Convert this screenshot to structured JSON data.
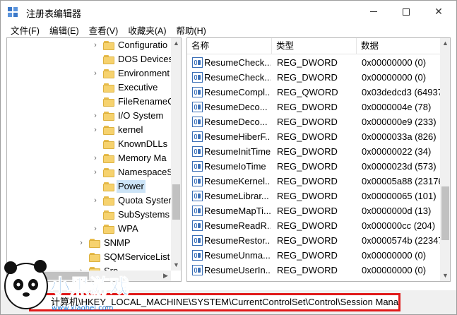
{
  "window": {
    "title": "注册表编辑器",
    "controls": {
      "minimize": "minimize",
      "maximize": "maximize",
      "close": "✕"
    }
  },
  "menu": [
    "文件(F)",
    "编辑(E)",
    "查看(V)",
    "收藏夹(A)",
    "帮助(H)"
  ],
  "tree": {
    "items": [
      {
        "label": "Configuratio",
        "level": 2,
        "expander": true
      },
      {
        "label": "DOS Devices",
        "level": 2,
        "expander": false
      },
      {
        "label": "Environment",
        "level": 2,
        "expander": true
      },
      {
        "label": "Executive",
        "level": 2,
        "expander": false
      },
      {
        "label": "FileRenameC",
        "level": 2,
        "expander": false
      },
      {
        "label": "I/O System",
        "level": 2,
        "expander": true
      },
      {
        "label": "kernel",
        "level": 2,
        "expander": true
      },
      {
        "label": "KnownDLLs",
        "level": 2,
        "expander": false
      },
      {
        "label": "Memory Ma",
        "level": 2,
        "expander": true
      },
      {
        "label": "NamespaceS",
        "level": 2,
        "expander": true
      },
      {
        "label": "Power",
        "level": 2,
        "expander": false,
        "selected": true
      },
      {
        "label": "Quota Syster",
        "level": 2,
        "expander": true
      },
      {
        "label": "SubSystems",
        "level": 2,
        "expander": false
      },
      {
        "label": "WPA",
        "level": 2,
        "expander": true
      },
      {
        "label": "SNMP",
        "level": 1,
        "expander": true
      },
      {
        "label": "SQMServiceList",
        "level": 1,
        "expander": false
      },
      {
        "label": "Srp",
        "level": 1,
        "expander": true
      }
    ]
  },
  "values_pane": {
    "headers": {
      "name": "名称",
      "type": "类型",
      "data": "数据"
    },
    "rows": [
      {
        "name": "ResumeCheck...",
        "type": "REG_DWORD",
        "data": "0x00000000 (0)"
      },
      {
        "name": "ResumeCheck...",
        "type": "REG_DWORD",
        "data": "0x00000000 (0)"
      },
      {
        "name": "ResumeCompl...",
        "type": "REG_QWORD",
        "data": "0x03dedcd3 (64937"
      },
      {
        "name": "ResumeDeco...",
        "type": "REG_DWORD",
        "data": "0x0000004e (78)"
      },
      {
        "name": "ResumeDeco...",
        "type": "REG_DWORD",
        "data": "0x000000e9 (233)"
      },
      {
        "name": "ResumeHiberF...",
        "type": "REG_DWORD",
        "data": "0x0000033a (826)"
      },
      {
        "name": "ResumeInitTime",
        "type": "REG_DWORD",
        "data": "0x00000022 (34)"
      },
      {
        "name": "ResumeIoTime",
        "type": "REG_DWORD",
        "data": "0x0000023d (573)"
      },
      {
        "name": "ResumeKernel...",
        "type": "REG_DWORD",
        "data": "0x00005a88 (23176"
      },
      {
        "name": "ResumeLibrar...",
        "type": "REG_DWORD",
        "data": "0x00000065 (101)"
      },
      {
        "name": "ResumeMapTi...",
        "type": "REG_DWORD",
        "data": "0x0000000d (13)"
      },
      {
        "name": "ResumeReadR...",
        "type": "REG_DWORD",
        "data": "0x000000cc (204)"
      },
      {
        "name": "ResumeRestor...",
        "type": "REG_DWORD",
        "data": "0x0000574b (22347"
      },
      {
        "name": "ResumeUnma...",
        "type": "REG_DWORD",
        "data": "0x00000000 (0)"
      },
      {
        "name": "ResumeUserIn...",
        "type": "REG_DWORD",
        "data": "0x00000000 (0)"
      }
    ]
  },
  "status": {
    "path": "计算机\\HKEY_LOCAL_MACHINE\\SYSTEM\\CurrentControlSet\\Control\\Session Manager\\Power"
  },
  "watermark": {
    "text": "小黑游戏",
    "url": "www.xiaohei.com"
  },
  "colors": {
    "selection": "#cce4f7",
    "highlight_border": "#e01a1a",
    "folder": "#f6d26e"
  }
}
